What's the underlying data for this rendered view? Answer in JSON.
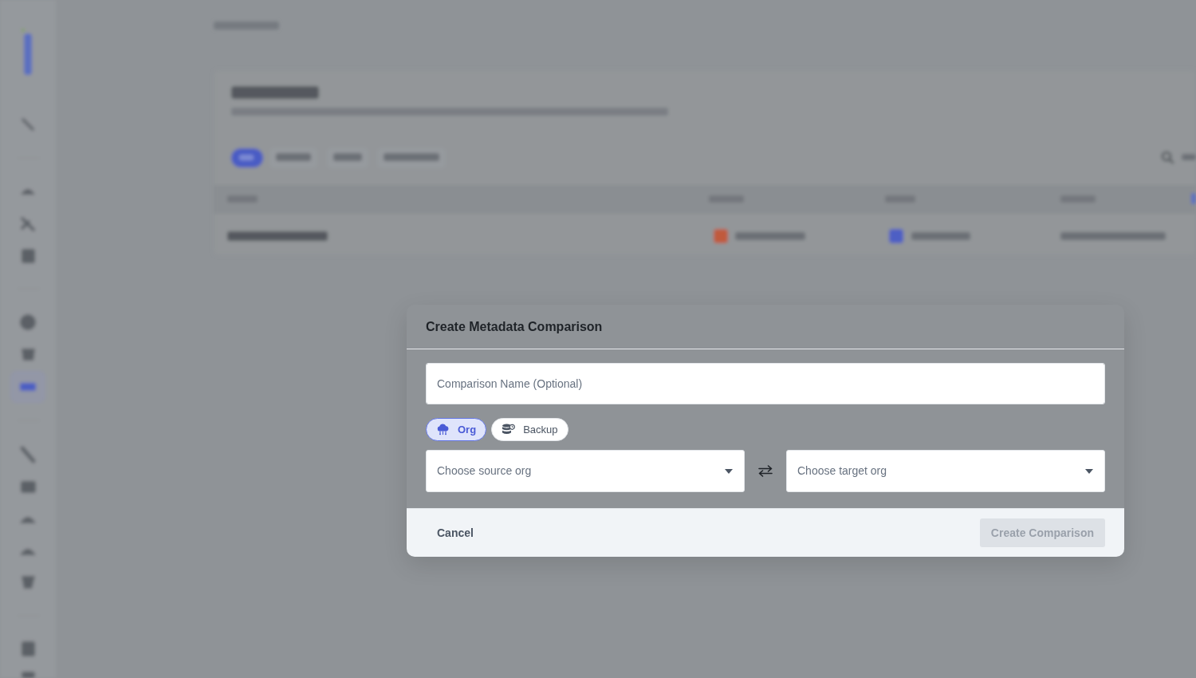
{
  "dialog": {
    "title": "Create Metadata Comparison",
    "name_field": {
      "placeholder": "Comparison Name (Optional)"
    },
    "source_types": [
      {
        "label": "Org",
        "kind": "org",
        "selected": true
      },
      {
        "label": "Backup",
        "kind": "backup",
        "selected": false
      }
    ],
    "source_select": {
      "placeholder": "Choose source org"
    },
    "target_select": {
      "placeholder": "Choose target org"
    },
    "buttons": [
      {
        "label": "Cancel",
        "kind": "cancel",
        "disabled": false
      },
      {
        "label": "Create Comparison",
        "kind": "primary",
        "disabled": true
      }
    ]
  }
}
